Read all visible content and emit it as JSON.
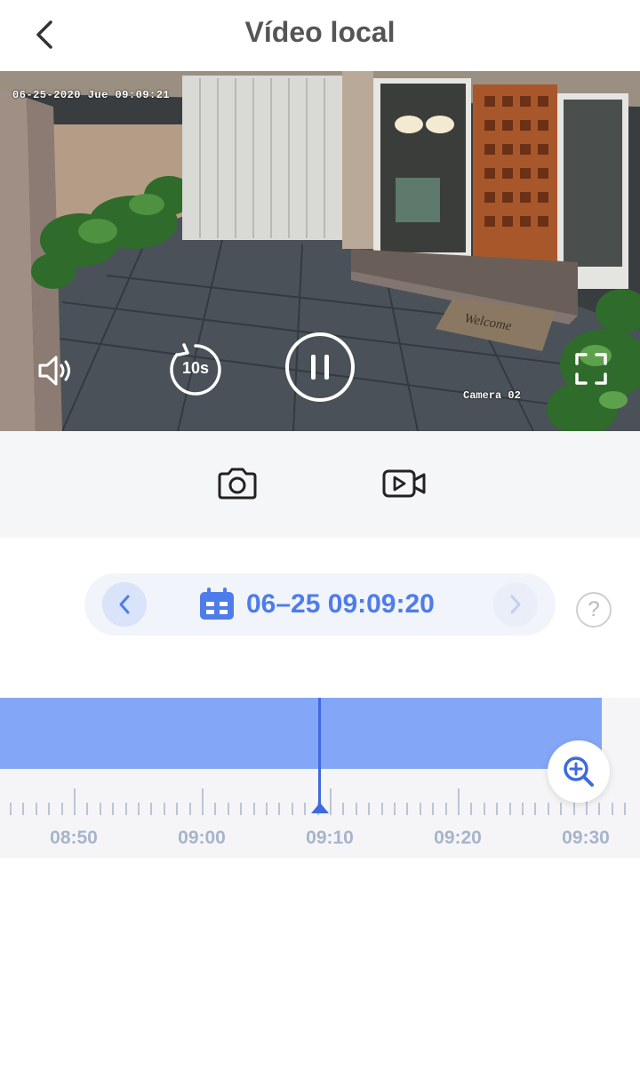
{
  "header": {
    "title": "Vídeo local",
    "back_icon": "chevron-left-icon"
  },
  "video": {
    "osd_timestamp": "06-25-2020 Jue 09:09:21",
    "osd_camera": "Camera 02",
    "doormat_text": "Welcome",
    "controls": {
      "volume_icon": "speaker-icon",
      "replay_label": "10s",
      "pause_icon": "pause-icon",
      "fullscreen_icon": "fullscreen-icon"
    }
  },
  "toolbar": {
    "snapshot_icon": "camera-icon",
    "record_icon": "video-record-icon"
  },
  "date_nav": {
    "prev_icon": "chevron-left-icon",
    "calendar_icon": "calendar-icon",
    "datetime": "06–25 09:09:20",
    "next_icon": "chevron-right-icon",
    "help_label": "?"
  },
  "timeline": {
    "labels": [
      "08:50",
      "09:00",
      "09:10",
      "09:20",
      "09:30"
    ],
    "current_time": "09:09:20",
    "zoom_icon": "zoom-in-icon",
    "colors": {
      "recording": "#84a6f6",
      "cursor": "#3e6ae0"
    }
  }
}
